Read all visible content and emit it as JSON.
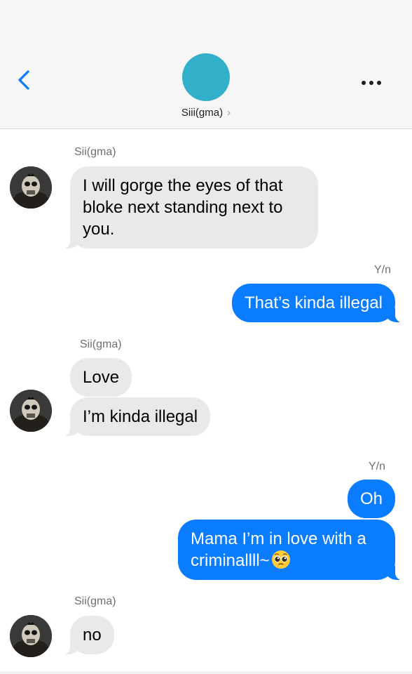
{
  "header": {
    "contact_name": "Siii(gma)",
    "chevron": "›",
    "back_icon": "chevron-left-icon",
    "more_icon": "ellipsis-icon",
    "avatar_color": "#33b0c9"
  },
  "colors": {
    "incoming_bubble": "#e9e9eb",
    "outgoing_bubble": "#0a7cff",
    "accent": "#0a7cff"
  },
  "thread": [
    {
      "sender": "Sii(gma)",
      "direction": "incoming",
      "messages": [
        "I will gorge the eyes of that bloke next standing next to you."
      ]
    },
    {
      "sender": "Y/n",
      "direction": "outgoing",
      "messages": [
        "That’s kinda illegal"
      ]
    },
    {
      "sender": "Sii(gma)",
      "direction": "incoming",
      "messages": [
        "Love",
        "I’m kinda illegal"
      ]
    },
    {
      "sender": "Y/n",
      "direction": "outgoing",
      "messages": [
        "Oh",
        "Mama I’m in love with a criminallll~"
      ],
      "emoji_after_last": "pleading-face-icon"
    },
    {
      "sender": "Sii(gma)",
      "direction": "incoming",
      "messages": [
        "no"
      ]
    }
  ]
}
